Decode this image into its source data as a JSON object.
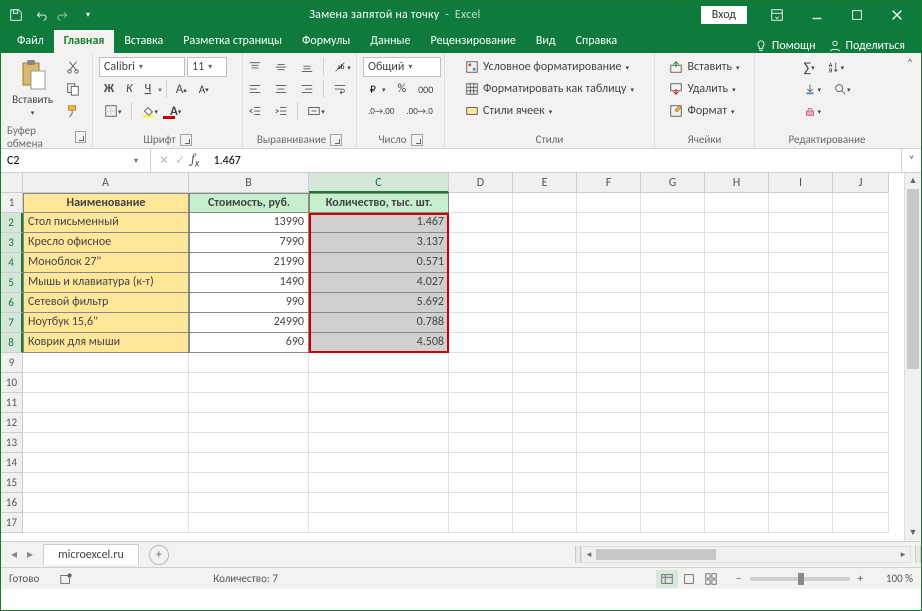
{
  "title": {
    "doc": "Замена запятой на точку",
    "app": "Excel"
  },
  "titlebar": {
    "login": "Вход"
  },
  "tabs": [
    "Файл",
    "Главная",
    "Вставка",
    "Разметка страницы",
    "Формулы",
    "Данные",
    "Рецензирование",
    "Вид",
    "Справка"
  ],
  "tabs_active_index": 1,
  "ribbon_right": {
    "tell_me": "Помощн",
    "share": "Поделиться"
  },
  "ribbon": {
    "clipboard": {
      "paste": "Вставить",
      "label": "Буфер обмена"
    },
    "font": {
      "name": "Calibri",
      "size": "11",
      "label": "Шрифт",
      "bold": "Ж",
      "italic": "К",
      "underline": "Ч"
    },
    "alignment": {
      "label": "Выравнивание"
    },
    "number": {
      "format": "Общий",
      "label": "Число"
    },
    "styles": {
      "cond": "Условное форматирование",
      "table": "Форматировать как таблицу",
      "cell": "Стили ячеек",
      "label": "Стили"
    },
    "cells": {
      "insert": "Вставить",
      "delete": "Удалить",
      "format": "Формат",
      "label": "Ячейки"
    },
    "editing": {
      "label": "Редактирование"
    }
  },
  "formula_bar": {
    "name_box": "C2",
    "formula": "1.467"
  },
  "columns": [
    {
      "l": "A",
      "w": 166
    },
    {
      "l": "B",
      "w": 120
    },
    {
      "l": "C",
      "w": 140
    },
    {
      "l": "D",
      "w": 64
    },
    {
      "l": "E",
      "w": 64
    },
    {
      "l": "F",
      "w": 64
    },
    {
      "l": "G",
      "w": 64
    },
    {
      "l": "H",
      "w": 64
    },
    {
      "l": "I",
      "w": 64
    },
    {
      "l": "J",
      "w": 56
    }
  ],
  "selected_col_index": 2,
  "rows_visible": 17,
  "selected_rows": [
    2,
    3,
    4,
    5,
    6,
    7,
    8
  ],
  "headers": {
    "a": "Наименование",
    "b": "Стоимость, руб.",
    "c": "Количество, тыс. шт."
  },
  "data": [
    {
      "a": "Стол письменный",
      "b": "13990",
      "c": "1.467"
    },
    {
      "a": "Кресло офисное",
      "b": "7990",
      "c": "3.137"
    },
    {
      "a": "Моноблок 27\"",
      "b": "21990",
      "c": "0.571"
    },
    {
      "a": "Мышь и клавиатура (к-т)",
      "b": "1490",
      "c": "4.027"
    },
    {
      "a": "Сетевой фильтр",
      "b": "990",
      "c": "5.692"
    },
    {
      "a": "Ноутбук 15,6\"",
      "b": "24990",
      "c": "0.788"
    },
    {
      "a": "Коврик для мыши",
      "b": "690",
      "c": "4.508"
    }
  ],
  "chart_data": {
    "type": "table",
    "columns": [
      "Наименование",
      "Стоимость, руб.",
      "Количество, тыс. шт."
    ],
    "rows": [
      [
        "Стол письменный",
        13990,
        1.467
      ],
      [
        "Кресло офисное",
        7990,
        3.137
      ],
      [
        "Моноблок 27\"",
        21990,
        0.571
      ],
      [
        "Мышь и клавиатура (к-т)",
        1490,
        4.027
      ],
      [
        "Сетевой фильтр",
        990,
        5.692
      ],
      [
        "Ноутбук 15,6\"",
        24990,
        0.788
      ],
      [
        "Коврик для мыши",
        690,
        4.508
      ]
    ]
  },
  "sheet_tabs": {
    "active": "microexcel.ru"
  },
  "status": {
    "ready": "Готово",
    "count_label": "Количество:",
    "count_value": "7",
    "zoom": "100 %"
  }
}
